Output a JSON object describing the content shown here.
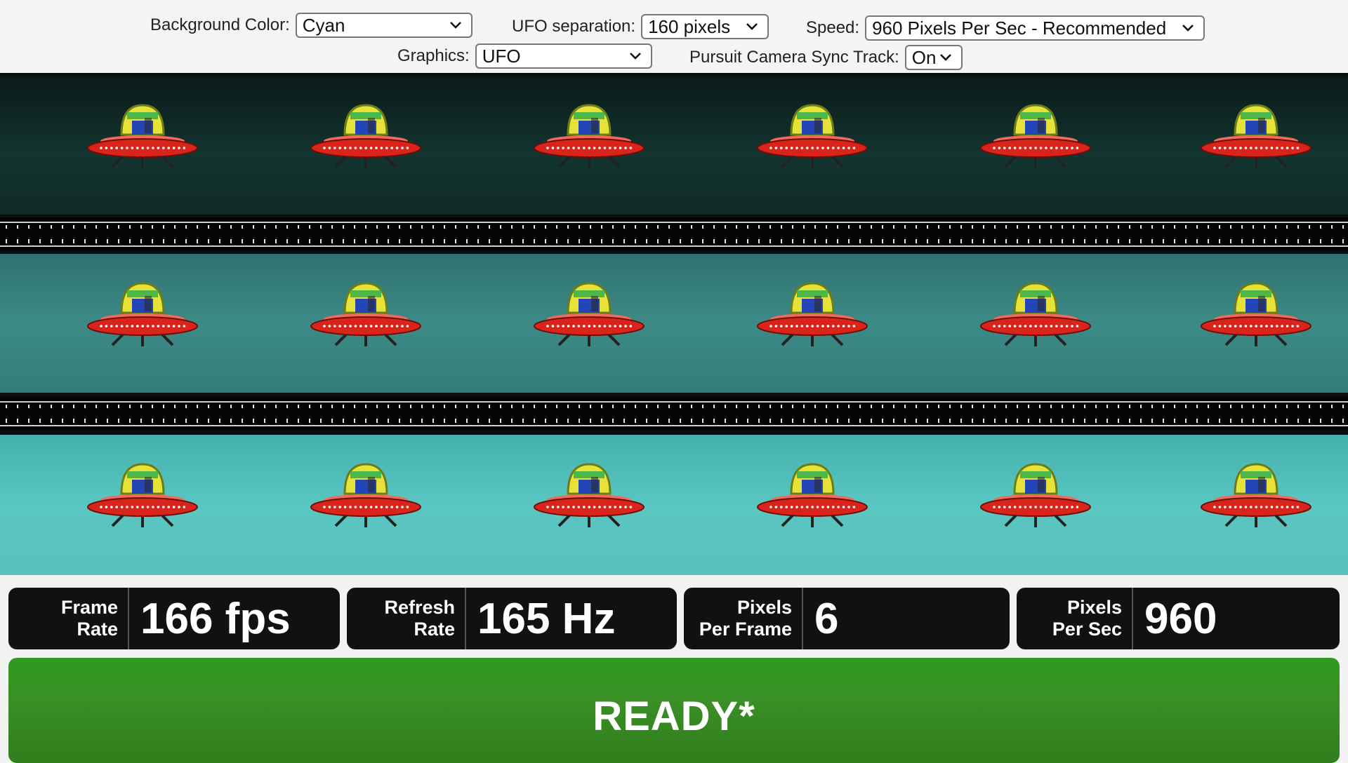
{
  "controls": {
    "background_color": {
      "label": "Background Color:",
      "value": "Cyan"
    },
    "ufo_separation": {
      "label": "UFO separation:",
      "value": "160 pixels"
    },
    "speed": {
      "label": "Speed:",
      "value": "960 Pixels Per Sec - Recommended"
    },
    "graphics": {
      "label": "Graphics:",
      "value": "UFO"
    },
    "pursuit_camera": {
      "label": "Pursuit Camera Sync Track:",
      "value": "On"
    }
  },
  "lanes": [
    {
      "name": "dark-lane",
      "background": "#133430",
      "ufo_count": 6
    },
    {
      "name": "medium-lane",
      "background": "#3c8a86",
      "ufo_count": 6
    },
    {
      "name": "light-lane",
      "background": "#5ac6c1",
      "ufo_count": 6
    }
  ],
  "stats": {
    "frame_rate": {
      "label_line1": "Frame",
      "label_line2": "Rate",
      "value": "166 fps"
    },
    "refresh_rate": {
      "label_line1": "Refresh",
      "label_line2": "Rate",
      "value": "165 Hz"
    },
    "pixels_per_frame": {
      "label_line1": "Pixels",
      "label_line2": "Per Frame",
      "value": "6"
    },
    "pixels_per_sec": {
      "label_line1": "Pixels",
      "label_line2": "Per Sec",
      "value": "960"
    }
  },
  "status": {
    "text": "READY*",
    "color": "#2f9a1e"
  },
  "colors": {
    "ufo_dome": "#e7e23a",
    "ufo_saucer": "#d9241c",
    "track": "#050505"
  }
}
